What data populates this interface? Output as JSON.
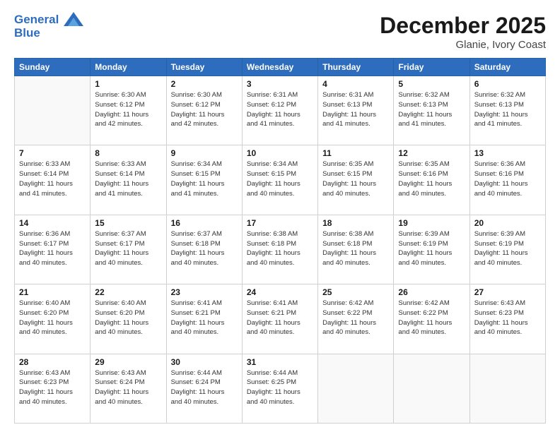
{
  "logo": {
    "line1": "General",
    "line2": "Blue"
  },
  "title": "December 2025",
  "location": "Glanie, Ivory Coast",
  "days_header": [
    "Sunday",
    "Monday",
    "Tuesday",
    "Wednesday",
    "Thursday",
    "Friday",
    "Saturday"
  ],
  "weeks": [
    [
      {
        "day": "",
        "info": ""
      },
      {
        "day": "1",
        "info": "Sunrise: 6:30 AM\nSunset: 6:12 PM\nDaylight: 11 hours\nand 42 minutes."
      },
      {
        "day": "2",
        "info": "Sunrise: 6:30 AM\nSunset: 6:12 PM\nDaylight: 11 hours\nand 42 minutes."
      },
      {
        "day": "3",
        "info": "Sunrise: 6:31 AM\nSunset: 6:12 PM\nDaylight: 11 hours\nand 41 minutes."
      },
      {
        "day": "4",
        "info": "Sunrise: 6:31 AM\nSunset: 6:13 PM\nDaylight: 11 hours\nand 41 minutes."
      },
      {
        "day": "5",
        "info": "Sunrise: 6:32 AM\nSunset: 6:13 PM\nDaylight: 11 hours\nand 41 minutes."
      },
      {
        "day": "6",
        "info": "Sunrise: 6:32 AM\nSunset: 6:13 PM\nDaylight: 11 hours\nand 41 minutes."
      }
    ],
    [
      {
        "day": "7",
        "info": "Sunrise: 6:33 AM\nSunset: 6:14 PM\nDaylight: 11 hours\nand 41 minutes."
      },
      {
        "day": "8",
        "info": "Sunrise: 6:33 AM\nSunset: 6:14 PM\nDaylight: 11 hours\nand 41 minutes."
      },
      {
        "day": "9",
        "info": "Sunrise: 6:34 AM\nSunset: 6:15 PM\nDaylight: 11 hours\nand 41 minutes."
      },
      {
        "day": "10",
        "info": "Sunrise: 6:34 AM\nSunset: 6:15 PM\nDaylight: 11 hours\nand 40 minutes."
      },
      {
        "day": "11",
        "info": "Sunrise: 6:35 AM\nSunset: 6:15 PM\nDaylight: 11 hours\nand 40 minutes."
      },
      {
        "day": "12",
        "info": "Sunrise: 6:35 AM\nSunset: 6:16 PM\nDaylight: 11 hours\nand 40 minutes."
      },
      {
        "day": "13",
        "info": "Sunrise: 6:36 AM\nSunset: 6:16 PM\nDaylight: 11 hours\nand 40 minutes."
      }
    ],
    [
      {
        "day": "14",
        "info": "Sunrise: 6:36 AM\nSunset: 6:17 PM\nDaylight: 11 hours\nand 40 minutes."
      },
      {
        "day": "15",
        "info": "Sunrise: 6:37 AM\nSunset: 6:17 PM\nDaylight: 11 hours\nand 40 minutes."
      },
      {
        "day": "16",
        "info": "Sunrise: 6:37 AM\nSunset: 6:18 PM\nDaylight: 11 hours\nand 40 minutes."
      },
      {
        "day": "17",
        "info": "Sunrise: 6:38 AM\nSunset: 6:18 PM\nDaylight: 11 hours\nand 40 minutes."
      },
      {
        "day": "18",
        "info": "Sunrise: 6:38 AM\nSunset: 6:18 PM\nDaylight: 11 hours\nand 40 minutes."
      },
      {
        "day": "19",
        "info": "Sunrise: 6:39 AM\nSunset: 6:19 PM\nDaylight: 11 hours\nand 40 minutes."
      },
      {
        "day": "20",
        "info": "Sunrise: 6:39 AM\nSunset: 6:19 PM\nDaylight: 11 hours\nand 40 minutes."
      }
    ],
    [
      {
        "day": "21",
        "info": "Sunrise: 6:40 AM\nSunset: 6:20 PM\nDaylight: 11 hours\nand 40 minutes."
      },
      {
        "day": "22",
        "info": "Sunrise: 6:40 AM\nSunset: 6:20 PM\nDaylight: 11 hours\nand 40 minutes."
      },
      {
        "day": "23",
        "info": "Sunrise: 6:41 AM\nSunset: 6:21 PM\nDaylight: 11 hours\nand 40 minutes."
      },
      {
        "day": "24",
        "info": "Sunrise: 6:41 AM\nSunset: 6:21 PM\nDaylight: 11 hours\nand 40 minutes."
      },
      {
        "day": "25",
        "info": "Sunrise: 6:42 AM\nSunset: 6:22 PM\nDaylight: 11 hours\nand 40 minutes."
      },
      {
        "day": "26",
        "info": "Sunrise: 6:42 AM\nSunset: 6:22 PM\nDaylight: 11 hours\nand 40 minutes."
      },
      {
        "day": "27",
        "info": "Sunrise: 6:43 AM\nSunset: 6:23 PM\nDaylight: 11 hours\nand 40 minutes."
      }
    ],
    [
      {
        "day": "28",
        "info": "Sunrise: 6:43 AM\nSunset: 6:23 PM\nDaylight: 11 hours\nand 40 minutes."
      },
      {
        "day": "29",
        "info": "Sunrise: 6:43 AM\nSunset: 6:24 PM\nDaylight: 11 hours\nand 40 minutes."
      },
      {
        "day": "30",
        "info": "Sunrise: 6:44 AM\nSunset: 6:24 PM\nDaylight: 11 hours\nand 40 minutes."
      },
      {
        "day": "31",
        "info": "Sunrise: 6:44 AM\nSunset: 6:25 PM\nDaylight: 11 hours\nand 40 minutes."
      },
      {
        "day": "",
        "info": ""
      },
      {
        "day": "",
        "info": ""
      },
      {
        "day": "",
        "info": ""
      }
    ]
  ]
}
